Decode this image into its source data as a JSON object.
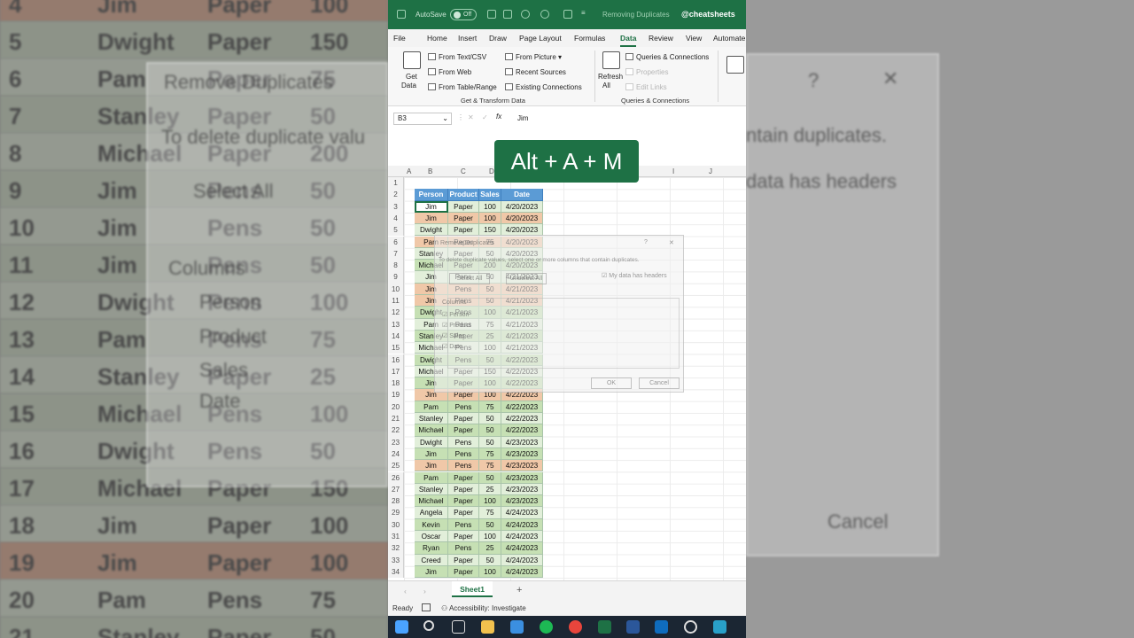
{
  "window": {
    "autosave_label": "AutoSave",
    "autosave_state": "Off",
    "document_title": "Removing Duplicates",
    "handle": "@cheatsheets"
  },
  "ribbon_tabs": [
    "File",
    "Home",
    "Insert",
    "Draw",
    "Page Layout",
    "Formulas",
    "Data",
    "Review",
    "View",
    "Automate"
  ],
  "active_tab": "Data",
  "ribbon": {
    "get_data": "Get",
    "get_data2": "Data",
    "from_text_csv": "From Text/CSV",
    "from_web": "From Web",
    "from_table_range": "From Table/Range",
    "from_picture": "From Picture",
    "recent_sources": "Recent Sources",
    "existing_connections": "Existing Connections",
    "group_get_transform": "Get & Transform Data",
    "refresh_all": "Refresh",
    "refresh_all2": "All",
    "queries_connections": "Queries & Connections",
    "properties": "Properties",
    "edit_links": "Edit Links",
    "group_queries": "Queries & Connections"
  },
  "formula_bar": {
    "name_box": "B3",
    "fx": "fx",
    "value": "Jim"
  },
  "column_headers": [
    "A",
    "B",
    "C",
    "D",
    "I",
    "J"
  ],
  "table": {
    "headers": [
      "Person",
      "Product",
      "Sales",
      "Date"
    ],
    "rows": [
      {
        "n": "3",
        "cells": [
          "Jim",
          "Paper",
          "100",
          "4/20/2023"
        ],
        "dup": false
      },
      {
        "n": "4",
        "cells": [
          "Jim",
          "Paper",
          "100",
          "4/20/2023"
        ],
        "dup": true
      },
      {
        "n": "5",
        "cells": [
          "Dwight",
          "Paper",
          "150",
          "4/20/2023"
        ],
        "dup": false
      },
      {
        "n": "6",
        "cells": [
          "Pam",
          "Paper",
          "75",
          "4/20/2023"
        ],
        "dup": true
      },
      {
        "n": "7",
        "cells": [
          "Stanley",
          "Paper",
          "50",
          "4/20/2023"
        ],
        "dup": false
      },
      {
        "n": "8",
        "cells": [
          "Michael",
          "Paper",
          "200",
          "4/20/2023"
        ],
        "dup": false
      },
      {
        "n": "9",
        "cells": [
          "Jim",
          "Pens",
          "50",
          "4/21/2023"
        ],
        "dup": false
      },
      {
        "n": "10",
        "cells": [
          "Jim",
          "Pens",
          "50",
          "4/21/2023"
        ],
        "dup": true
      },
      {
        "n": "11",
        "cells": [
          "Jim",
          "Pens",
          "50",
          "4/21/2023"
        ],
        "dup": true
      },
      {
        "n": "12",
        "cells": [
          "Dwight",
          "Pens",
          "100",
          "4/21/2023"
        ],
        "dup": false
      },
      {
        "n": "13",
        "cells": [
          "Pam",
          "Pens",
          "75",
          "4/21/2023"
        ],
        "dup": false
      },
      {
        "n": "14",
        "cells": [
          "Stanley",
          "Paper",
          "25",
          "4/21/2023"
        ],
        "dup": false
      },
      {
        "n": "15",
        "cells": [
          "Michael",
          "Pens",
          "100",
          "4/21/2023"
        ],
        "dup": false
      },
      {
        "n": "16",
        "cells": [
          "Dwight",
          "Pens",
          "50",
          "4/22/2023"
        ],
        "dup": false
      },
      {
        "n": "17",
        "cells": [
          "Michael",
          "Paper",
          "150",
          "4/22/2023"
        ],
        "dup": false
      },
      {
        "n": "18",
        "cells": [
          "Jim",
          "Paper",
          "100",
          "4/22/2023"
        ],
        "dup": false
      },
      {
        "n": "19",
        "cells": [
          "Jim",
          "Paper",
          "100",
          "4/22/2023"
        ],
        "dup": true
      },
      {
        "n": "20",
        "cells": [
          "Pam",
          "Pens",
          "75",
          "4/22/2023"
        ],
        "dup": false
      },
      {
        "n": "21",
        "cells": [
          "Stanley",
          "Paper",
          "50",
          "4/22/2023"
        ],
        "dup": false
      },
      {
        "n": "22",
        "cells": [
          "Michael",
          "Paper",
          "50",
          "4/22/2023"
        ],
        "dup": false
      },
      {
        "n": "23",
        "cells": [
          "Dwight",
          "Pens",
          "50",
          "4/23/2023"
        ],
        "dup": false
      },
      {
        "n": "24",
        "cells": [
          "Jim",
          "Pens",
          "75",
          "4/23/2023"
        ],
        "dup": false
      },
      {
        "n": "25",
        "cells": [
          "Jim",
          "Pens",
          "75",
          "4/23/2023"
        ],
        "dup": true
      },
      {
        "n": "26",
        "cells": [
          "Pam",
          "Paper",
          "50",
          "4/23/2023"
        ],
        "dup": false
      },
      {
        "n": "27",
        "cells": [
          "Stanley",
          "Paper",
          "25",
          "4/23/2023"
        ],
        "dup": false
      },
      {
        "n": "28",
        "cells": [
          "Michael",
          "Paper",
          "100",
          "4/23/2023"
        ],
        "dup": false
      },
      {
        "n": "29",
        "cells": [
          "Angela",
          "Paper",
          "75",
          "4/24/2023"
        ],
        "dup": false
      },
      {
        "n": "30",
        "cells": [
          "Kevin",
          "Pens",
          "50",
          "4/24/2023"
        ],
        "dup": false
      },
      {
        "n": "31",
        "cells": [
          "Oscar",
          "Paper",
          "100",
          "4/24/2023"
        ],
        "dup": false
      },
      {
        "n": "32",
        "cells": [
          "Ryan",
          "Pens",
          "25",
          "4/24/2023"
        ],
        "dup": false
      },
      {
        "n": "33",
        "cells": [
          "Creed",
          "Paper",
          "50",
          "4/24/2023"
        ],
        "dup": false
      },
      {
        "n": "34",
        "cells": [
          "Jim",
          "Paper",
          "100",
          "4/24/2023"
        ],
        "dup": false
      }
    ]
  },
  "dialog": {
    "title": "Remove Duplicates",
    "help": "?",
    "close": "✕",
    "instruction": "To delete duplicate values, select one or more columns that contain duplicates.",
    "select_all": "Select All",
    "unselect_all": "Unselect All",
    "headers_checkbox": "My data has headers",
    "columns_label": "Columns",
    "columns": [
      "Person",
      "Product",
      "Sales",
      "Date"
    ],
    "ok": "OK",
    "cancel": "Cancel"
  },
  "shortcut_overlay": "Alt + A + M",
  "sheet_tab": "Sheet1",
  "add_sheet": "+",
  "status": {
    "ready": "Ready",
    "accessibility": "Accessibility: Investigate"
  },
  "background_left": {
    "rows": [
      {
        "n": "4",
        "name": "Jim",
        "prod": "Paper",
        "val": "100",
        "dup": true
      },
      {
        "n": "5",
        "name": "Dwight",
        "prod": "Paper",
        "val": "150",
        "dup": false
      },
      {
        "n": "6",
        "name": "Pam",
        "prod": "Paper",
        "val": "75",
        "dup": false
      },
      {
        "n": "7",
        "name": "Stanley",
        "prod": "Paper",
        "val": "50",
        "dup": false
      },
      {
        "n": "8",
        "name": "Michael",
        "prod": "Paper",
        "val": "200",
        "dup": false
      },
      {
        "n": "9",
        "name": "Jim",
        "prod": "Pens",
        "val": "50",
        "dup": false
      },
      {
        "n": "10",
        "name": "Jim",
        "prod": "Pens",
        "val": "50",
        "dup": false
      },
      {
        "n": "11",
        "name": "Jim",
        "prod": "Pens",
        "val": "50",
        "dup": false
      },
      {
        "n": "12",
        "name": "Dwight",
        "prod": "Pens",
        "val": "100",
        "dup": false
      },
      {
        "n": "13",
        "name": "Pam",
        "prod": "Pens",
        "val": "75",
        "dup": false
      },
      {
        "n": "14",
        "name": "Stanley",
        "prod": "Paper",
        "val": "25",
        "dup": false
      },
      {
        "n": "15",
        "name": "Michael",
        "prod": "Pens",
        "val": "100",
        "dup": false
      },
      {
        "n": "16",
        "name": "Dwight",
        "prod": "Pens",
        "val": "50",
        "dup": false
      },
      {
        "n": "17",
        "name": "Michael",
        "prod": "Paper",
        "val": "150",
        "dup": false
      },
      {
        "n": "18",
        "name": "Jim",
        "prod": "Paper",
        "val": "100",
        "dup": false
      },
      {
        "n": "19",
        "name": "Jim",
        "prod": "Paper",
        "val": "100",
        "dup": true
      },
      {
        "n": "20",
        "name": "Pam",
        "prod": "Pens",
        "val": "75",
        "dup": false
      },
      {
        "n": "21",
        "name": "Stanley",
        "prod": "Paper",
        "val": "50",
        "dup": false
      }
    ],
    "ghost_texts": [
      "Remove Duplicates",
      "To delete duplicate valu",
      "Select All",
      "Columns",
      "Person",
      "Product",
      "Sales",
      "Date"
    ]
  },
  "background_right": {
    "ghost_texts": [
      "?",
      "✕",
      "ntain duplicates.",
      "data has headers",
      "Cancel"
    ]
  }
}
